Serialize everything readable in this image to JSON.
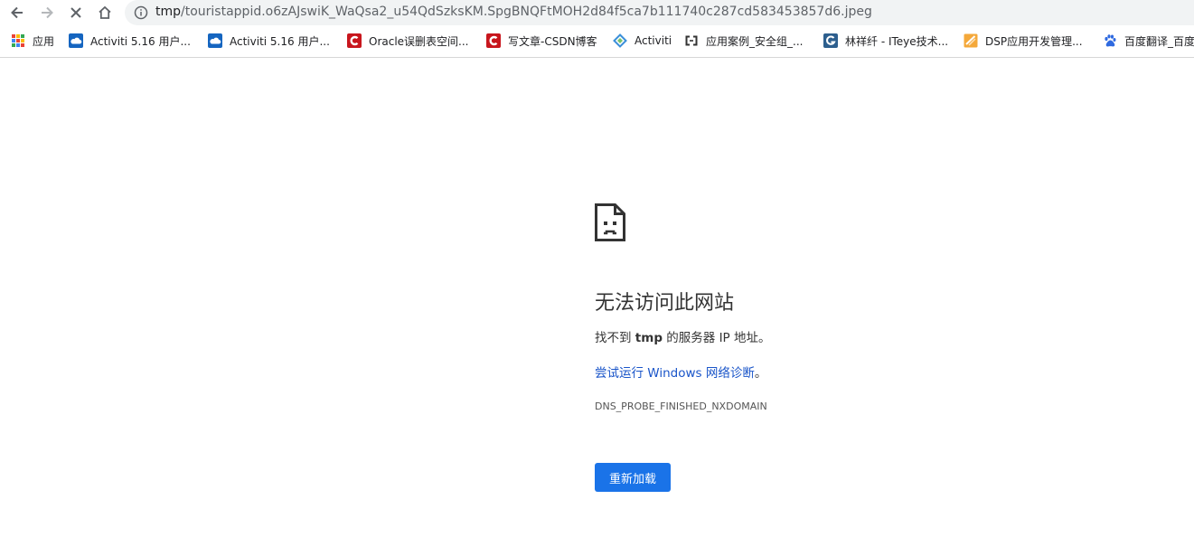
{
  "address_bar": {
    "url_host": "tmp",
    "url_rest": "/touristappid.o6zAJswiK_WaQsa2_u54QdSzksKM.SpgBNQFtMOH2d84f5ca7b111740c287cd583453857d6.jpeg"
  },
  "toolbar": {
    "back_icon": "back-arrow-icon",
    "forward_icon": "forward-arrow-icon",
    "stop_icon": "stop-x-icon",
    "home_icon": "home-icon",
    "info_icon": "info-icon"
  },
  "bookmarks": {
    "items": [
      {
        "label": "应用",
        "icon": "apps-grid-icon"
      },
      {
        "label": "Activiti 5.16 用户...",
        "icon": "cloud-icon",
        "color": "#1565c0"
      },
      {
        "label": "Activiti 5.16 用户...",
        "icon": "cloud-icon",
        "color": "#1565c0"
      },
      {
        "label": "Oracle误删表空间...",
        "icon": "csdn-icon",
        "color": "#c8161d"
      },
      {
        "label": "写文章-CSDN博客",
        "icon": "csdn-icon",
        "color": "#c8161d"
      },
      {
        "label": "Activiti",
        "icon": "diamond-icon",
        "color": "#3a8fd9"
      },
      {
        "label": "应用案例_安全组_...",
        "icon": "aliyun-icon",
        "color": "#333333"
      },
      {
        "label": "林祥纤 - ITeye技术...",
        "icon": "iteye-icon",
        "color": "#2d5f8e"
      },
      {
        "label": "DSP应用开发管理...",
        "icon": "folder-doc-icon",
        "color": "#f4a83a"
      },
      {
        "label": "百度翻译_百度",
        "icon": "baidu-paw-icon",
        "color": "#2f6ae0"
      }
    ]
  },
  "error": {
    "icon": "sad-page-icon",
    "title": "无法访问此网站",
    "desc_prefix": "找不到 ",
    "desc_host": "tmp",
    "desc_suffix": " 的服务器 IP 地址。",
    "link_text": "尝试运行 Windows 网络诊断",
    "link_tail": "。",
    "code": "DNS_PROBE_FINISHED_NXDOMAIN",
    "reload_label": "重新加载",
    "accent": "#1a73e8"
  }
}
